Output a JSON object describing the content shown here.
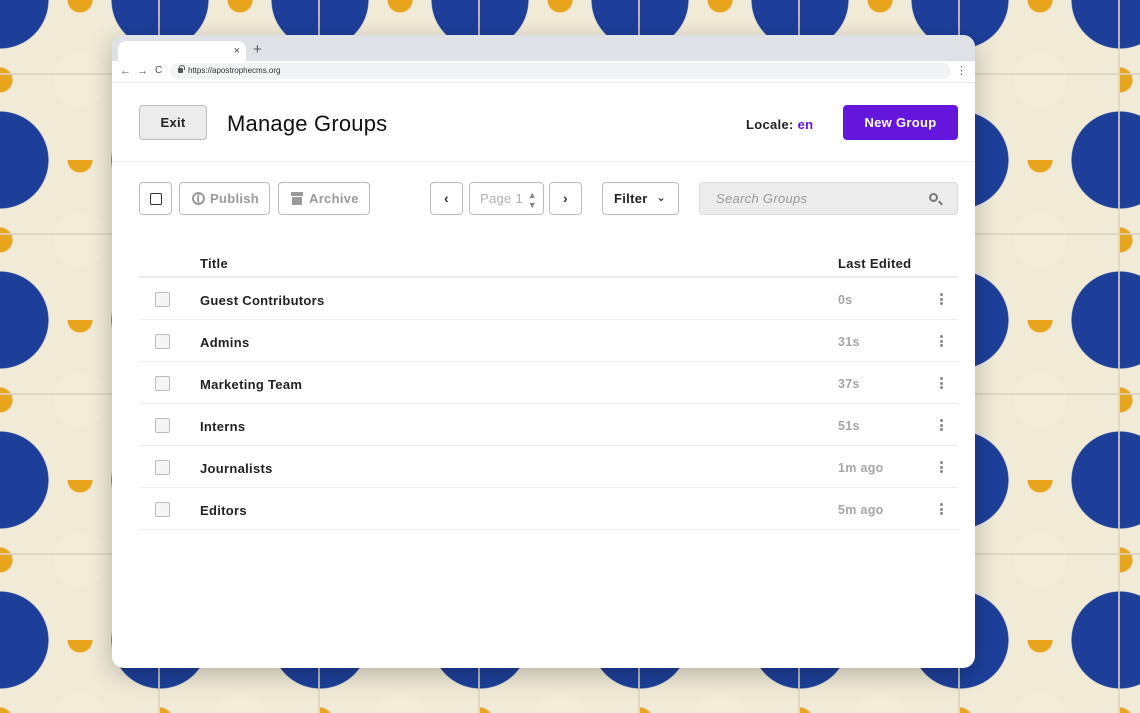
{
  "browser": {
    "tab_close": "×",
    "new_tab": "+",
    "back": "←",
    "forward": "→",
    "reload": "C",
    "url": "https://apostrophecms.org",
    "menu": "⋮"
  },
  "header": {
    "exit_label": "Exit",
    "title": "Manage Groups",
    "locale_label": "Locale:",
    "locale_value": "en",
    "new_button_label": "New Group",
    "accent_color": "#6516dd"
  },
  "toolbar": {
    "publish_label": "Publish",
    "archive_label": "Archive",
    "prev": "‹",
    "page_label": "Page 1",
    "next": "›",
    "filter_label": "Filter",
    "search_placeholder": "Search Groups"
  },
  "table": {
    "columns": [
      "Title",
      "Last Edited"
    ],
    "rows": [
      {
        "title": "Guest Contributors",
        "edited": "0s"
      },
      {
        "title": "Admins",
        "edited": "31s"
      },
      {
        "title": "Marketing Team",
        "edited": "37s"
      },
      {
        "title": "Interns",
        "edited": "51s"
      },
      {
        "title": "Journalists",
        "edited": "1m ago"
      },
      {
        "title": "Editors",
        "edited": "5m ago"
      }
    ]
  }
}
